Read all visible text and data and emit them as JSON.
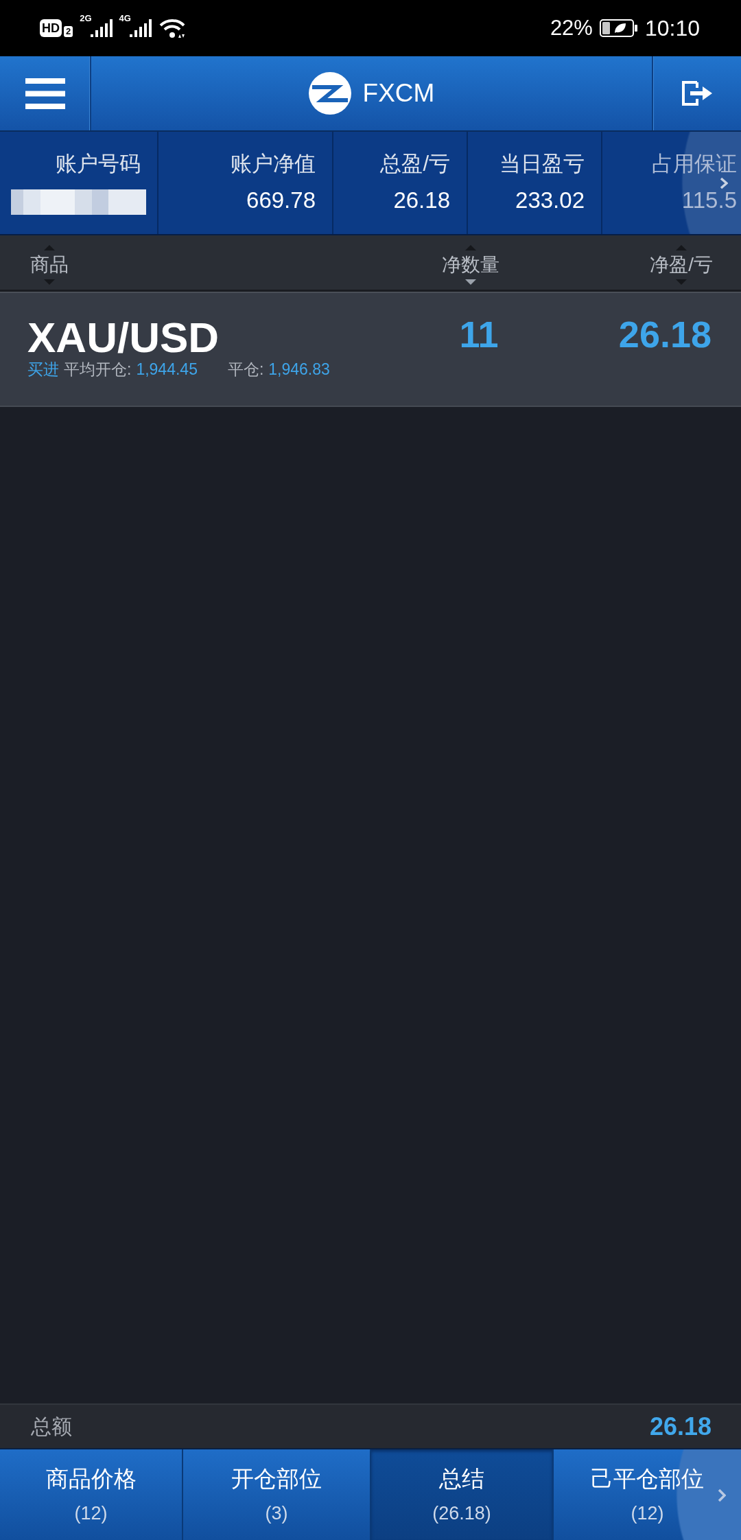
{
  "status_bar": {
    "hd_badge": "HD",
    "sim_badge": "2",
    "networks": [
      "2G",
      "4G"
    ],
    "battery": "22%",
    "time": "10:10"
  },
  "header": {
    "title": "FXCM"
  },
  "account_summary": [
    {
      "kind": "masked",
      "label": "账户号码"
    },
    {
      "kind": "value",
      "label": "账户净值",
      "value": "669.78"
    },
    {
      "kind": "value",
      "label": "总盈/亏",
      "value": "26.18"
    },
    {
      "kind": "value",
      "label": "当日盈亏",
      "value": "233.02"
    },
    {
      "kind": "value",
      "label": "占用保证",
      "value": "115.5"
    }
  ],
  "columns": [
    {
      "label": "商品",
      "sorted_descending": false
    },
    {
      "label": "净数量",
      "sorted_descending": true
    },
    {
      "label": "净盈/亏",
      "sorted_descending": false
    }
  ],
  "positions": [
    {
      "symbol": "XAU/USD",
      "side": "买进",
      "avg_open_label": "平均开仓:",
      "avg_open": "1,944.45",
      "close_label": "平仓:",
      "close": "1,946.83",
      "net_amount": "11",
      "net_pl": "26.18"
    }
  ],
  "total": {
    "label": "总额",
    "value": "26.18"
  },
  "tabs": [
    {
      "label": "商品价格",
      "count": "(12)",
      "selected": false
    },
    {
      "label": "开仓部位",
      "count": "(3)",
      "selected": false
    },
    {
      "label": "总结",
      "count": "(26.18)",
      "selected": true
    },
    {
      "label": "己平仓部位",
      "count": "(12)",
      "selected": false
    }
  ]
}
